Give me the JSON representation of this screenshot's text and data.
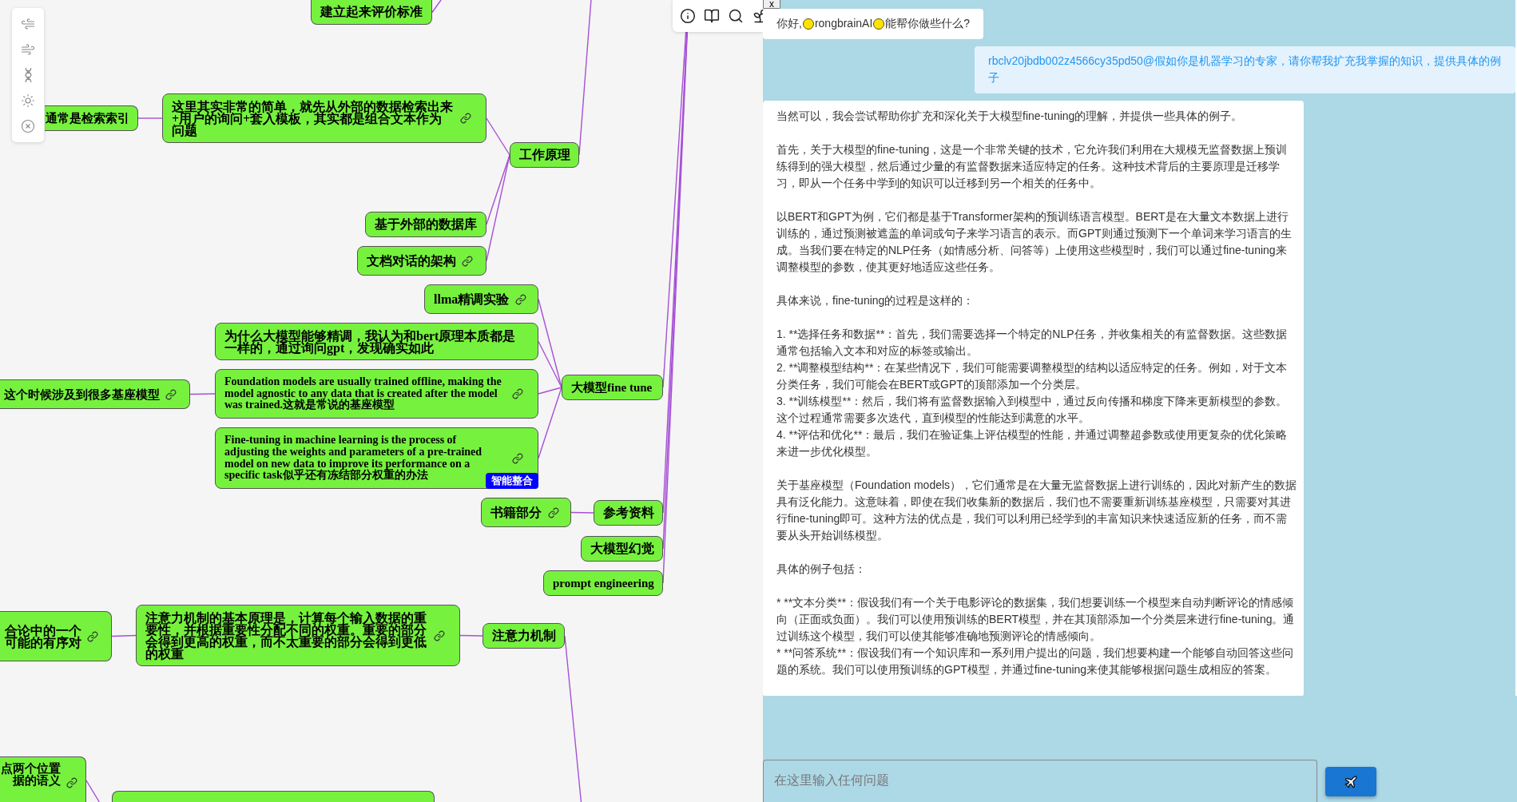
{
  "mindmap": {
    "nodes": [
      {
        "text": "建立起来评价标准",
        "link": false
      },
      {
        "text": "工作原理",
        "link": false,
        "children": [
          {
            "text": "这里其实非常的简单，就先从外部的数据检索出来+用户的询问+套入模板，其实都是组合文本作为问题",
            "link": true,
            "children": [
              {
                "text": "通常是检索索引",
                "link": false
              }
            ]
          },
          {
            "text": "基于外部的数据库",
            "link": false
          },
          {
            "text": "文档对话的架构",
            "link": true
          }
        ]
      },
      {
        "text": "大模型fine tune",
        "link": false,
        "children": [
          {
            "text": "llma精调实验",
            "link": true
          },
          {
            "text": "为什么大模型能够精调，我认为和bert原理本质都是一样的，通过询问gpt，发现确实如此",
            "link": false
          },
          {
            "text": "Foundation models are usually trained offline, making the model agnostic to any data that is created after the model was trained.这就是常说的基座模型",
            "link": true,
            "children": [
              {
                "text": "这个时候涉及到很多基座模型",
                "link": true
              }
            ]
          },
          {
            "text": "Fine-tuning in machine learning is the process of adjusting the weights and parameters of a pre-trained model on new data to improve its performance on a specific task似乎还有冻结部分权重的办法",
            "link": true,
            "badge": "智能整合"
          }
        ]
      },
      {
        "text": "参考资料",
        "link": false,
        "children": [
          {
            "text": "书籍部分",
            "link": true
          }
        ]
      },
      {
        "text": "大模型幻觉",
        "link": false
      },
      {
        "text": "prompt engineering",
        "link": false
      },
      {
        "text": "注意力机制",
        "link": false,
        "children": [
          {
            "text": "注意力机制的基本原理是，计算每个输入数据的重要性，并根据重要性分配不同的权重。重要的部分会得到更高的权重，而不太重要的部分会得到更低的权重",
            "link": true,
            "children": [
              {
                "lines": [
                  "合论中的一个",
                  "可能的有序对"
                ],
                "link": true
              }
            ]
          }
        ]
      },
      {
        "link": false,
        "children": [
          {
            "lines": [
              "点两个位置",
              "据的语义"
            ],
            "link": true
          }
        ]
      }
    ]
  },
  "chat": {
    "close_button": "x",
    "messages": [
      {
        "kind": "bot",
        "segments": [
          {
            "kind": "text",
            "text": "你好,"
          },
          {
            "kind": "emoji"
          },
          {
            "kind": "text",
            "text": "rongbrainAI"
          },
          {
            "kind": "emoji"
          },
          {
            "kind": "text",
            "text": "能帮你做些什么?"
          }
        ]
      },
      {
        "kind": "user",
        "text": "rbclv20jbdb002z4566cy35pd50@假如你是机器学习的专家，请你帮我扩充我掌握的知识，提供具体的例子"
      },
      {
        "kind": "bot",
        "blocks": [
          [
            "当然可以，我会尝试帮助你扩充和深化关于大模型fine-tuning的理解，并提供一些具体的例子。"
          ],
          [
            "首先，关于大模型的fine-tuning，这是一个非常关键的技术，它允许我们利用在大规模无监督数据上预训练得到的强大模型，然后通过少量的有监督数据来适应特定的任务。这种技术背后的主要原理是迁移学习，即从一个任务中学到的知识可以迁移到另一个相关的任务中。"
          ],
          [
            "以BERT和GPT为例，它们都是基于Transformer架构的预训练语言模型。BERT是在大量文本数据上进行训练的，通过预测被遮盖的单词或句子来学习语言的表示。而GPT则通过预测下一个单词来学习语言的生成。当我们要在特定的NLP任务（如情感分析、问答等）上使用这些模型时，我们可以通过fine-tuning来调整模型的参数，使其更好地适应这些任务。"
          ],
          [
            "具体来说，fine-tuning的过程是这样的："
          ],
          [
            "1. **选择任务和数据**：首先，我们需要选择一个特定的NLP任务，并收集相关的有监督数据。这些数据通常包括输入文本和对应的标签或输出。",
            "2. **调整模型结构**：在某些情况下，我们可能需要调整模型的结构以适应特定的任务。例如，对于文本分类任务，我们可能会在BERT或GPT的顶部添加一个分类层。",
            "3. **训练模型**：然后，我们将有监督数据输入到模型中，通过反向传播和梯度下降来更新模型的参数。这个过程通常需要多次迭代，直到模型的性能达到满意的水平。",
            "4. **评估和优化**：最后，我们在验证集上评估模型的性能，并通过调整超参数或使用更复杂的优化策略来进一步优化模型。"
          ],
          [
            "关于基座模型（Foundation models），它们通常是在大量无监督数据上进行训练的，因此对新产生的数据具有泛化能力。这意味着，即使在我们收集新的数据后，我们也不需要重新训练基座模型，只需要对其进行fine-tuning即可。这种方法的优点是，我们可以利用已经学到的丰富知识来快速适应新的任务，而不需要从头开始训练模型。"
          ],
          [
            "具体的例子包括："
          ],
          [
            "* **文本分类**：假设我们有一个关于电影评论的数据集，我们想要训练一个模型来自动判断评论的情感倾向（正面或负面）。我们可以使用预训练的BERT模型，并在其顶部添加一个分类层来进行fine-tuning。通过训练这个模型，我们可以使其能够准确地预测评论的情感倾向。",
            "* **问答系统**：假设我们有一个知识库和一系列用户提出的问题，我们想要构建一个能够自动回答这些问题的系统。我们可以使用预训练的GPT模型，并通过fine-tuning来使其能够根据问题生成相应的答案。"
          ]
        ]
      }
    ],
    "input": {
      "placeholder": "在这里输入任何问题"
    }
  }
}
